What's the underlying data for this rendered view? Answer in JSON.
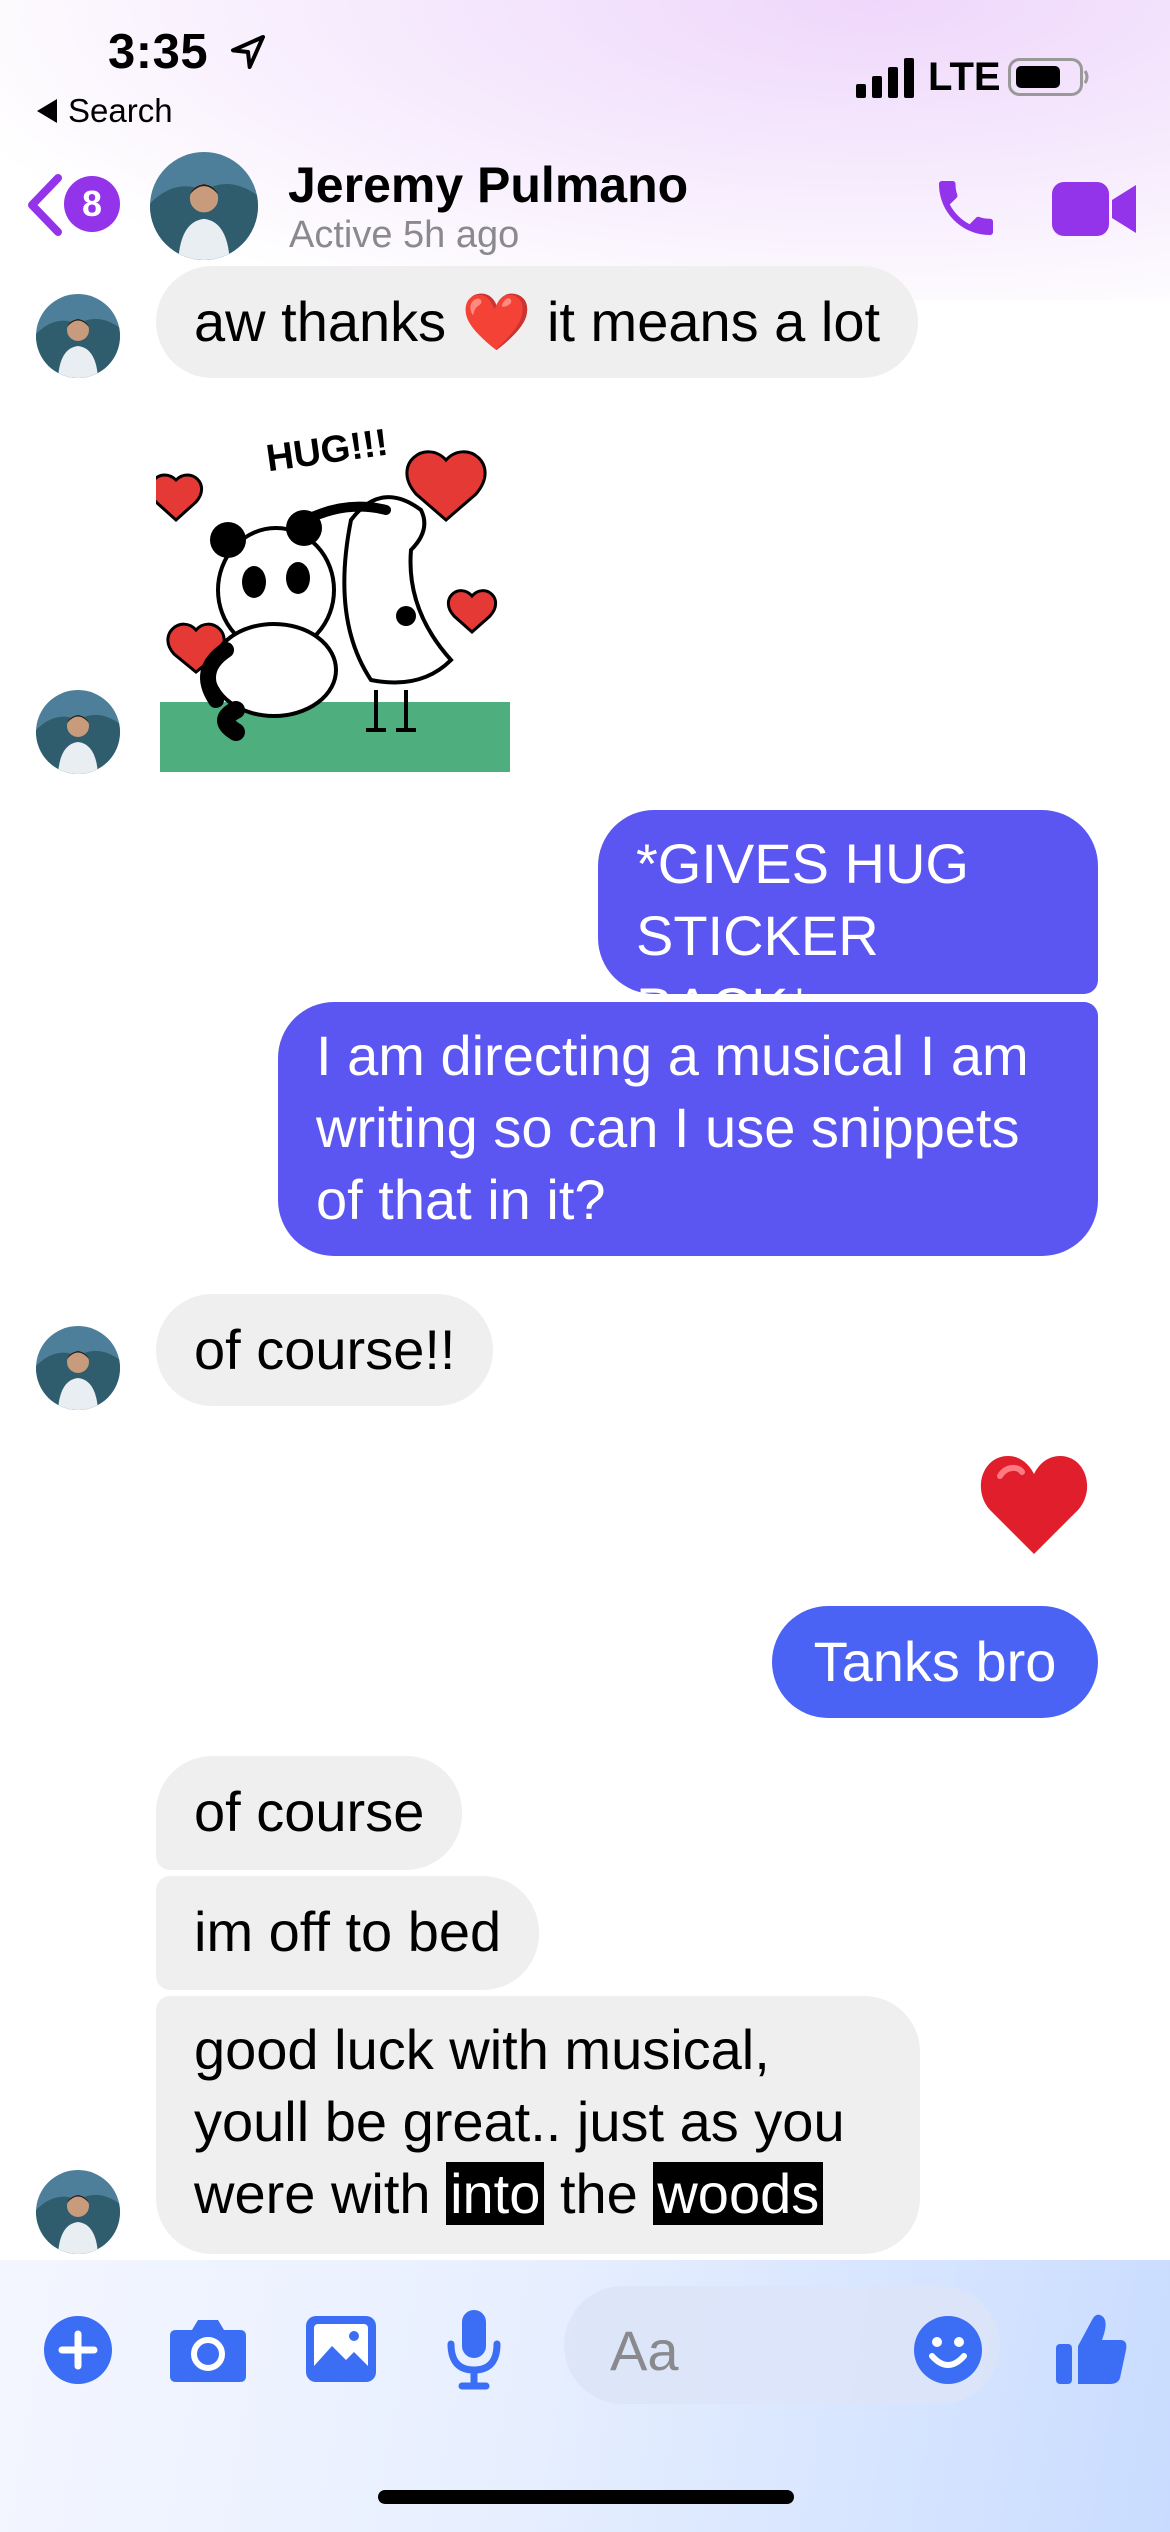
{
  "status_bar": {
    "time": "3:35",
    "back_label": "Search",
    "network": "LTE"
  },
  "header": {
    "back_badge_count": "8",
    "name": "Jeremy Pulmano",
    "status": "Active 5h ago"
  },
  "sticker": {
    "caption": "HUG!!!"
  },
  "messages": [
    {
      "from": "them",
      "text": "aw thanks ❤️ it means a lot"
    },
    {
      "from": "them",
      "type": "sticker"
    },
    {
      "from": "me",
      "text": "*GIVES HUG\nSTICKER BACK*"
    },
    {
      "from": "me",
      "text": "I am directing a musical I am\nwriting so can I use snippets\nof that in it?"
    },
    {
      "from": "them",
      "text": "of course!!"
    },
    {
      "from": "me",
      "type": "emoji",
      "text": "❤️"
    },
    {
      "from": "me",
      "text": "Tanks bro"
    },
    {
      "from": "them",
      "text": "of course"
    },
    {
      "from": "them",
      "text": "im off to bed"
    },
    {
      "from": "them",
      "parts": [
        "good luck with musical,\nyoull be great.. just as you\nwere with ",
        "into",
        " the ",
        "woods"
      ]
    }
  ],
  "composer": {
    "placeholder": "Aa"
  },
  "colors": {
    "accent": "#9333ea",
    "outgoing": "#5b55f2",
    "outgoing_blue": "#4a63f5",
    "composer_icons": "#3b6ef5",
    "incoming": "#efefef"
  },
  "icons": [
    "location-arrow-icon",
    "back-triangle-icon",
    "signal-icon",
    "battery-icon",
    "chevron-left-icon",
    "phone-icon",
    "video-camera-icon",
    "plus-icon",
    "camera-icon",
    "photo-icon",
    "microphone-icon",
    "smiley-icon",
    "thumbs-up-icon"
  ]
}
